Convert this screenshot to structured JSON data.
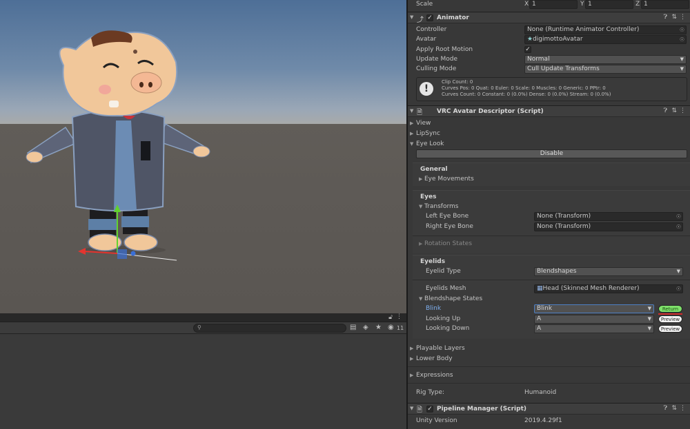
{
  "scene": {
    "gizmo_colors": {
      "x": "#e3352f",
      "y": "#62d22e",
      "z": "#3a6fd6"
    }
  },
  "bottom_panel": {
    "lock_icon": "lock-icon",
    "search_placeholder": "",
    "hidden_count": "11"
  },
  "inspector": {
    "transform_scale": {
      "label": "Scale",
      "x_label": "X",
      "x": "1",
      "y_label": "Y",
      "y": "1",
      "z_label": "Z",
      "z": "1"
    },
    "animator": {
      "title": "Animator",
      "enabled": true,
      "controller_label": "Controller",
      "controller_value": "None (Runtime Animator Controller)",
      "avatar_label": "Avatar",
      "avatar_value": "digimottoAvatar",
      "apply_root_motion_label": "Apply Root Motion",
      "update_mode_label": "Update Mode",
      "update_mode_value": "Normal",
      "culling_mode_label": "Culling Mode",
      "culling_mode_value": "Cull Update Transforms",
      "info_line1": "Clip Count: 0",
      "info_line2": "Curves Pos: 0 Quat: 0 Euler: 0 Scale: 0 Muscles: 0 Generic: 0 PPtr: 0",
      "info_line3": "Curves Count: 0 Constant: 0 (0.0%) Dense: 0 (0.0%) Stream: 0 (0.0%)"
    },
    "descriptor": {
      "title": "VRC Avatar Descriptor (Script)",
      "view": "View",
      "lipsync": "LipSync",
      "eye_look": "Eye Look",
      "disable_button": "Disable",
      "general_header": "General",
      "eye_movements": "Eye Movements",
      "eyes_header": "Eyes",
      "transforms": "Transforms",
      "left_eye_label": "Left Eye Bone",
      "left_eye_value": "None (Transform)",
      "right_eye_label": "Right Eye Bone",
      "right_eye_value": "None (Transform)",
      "rotation_states": "Rotation States",
      "eyelids_header": "Eyelids",
      "eyelid_type_label": "Eyelid Type",
      "eyelid_type_value": "Blendshapes",
      "eyelids_mesh_label": "Eyelids Mesh",
      "eyelids_mesh_value": "Head (Skinned Mesh Renderer)",
      "blendshape_states": "Blendshape States",
      "states": [
        {
          "label": "Blink",
          "value": "Blink",
          "button": "Return"
        },
        {
          "label": "Looking Up",
          "value": "A",
          "button": "Preview"
        },
        {
          "label": "Looking Down",
          "value": "A",
          "button": "Preview"
        }
      ],
      "playable_layers": "Playable Layers",
      "lower_body": "Lower Body",
      "expressions": "Expressions",
      "rig_type_label": "Rig Type:",
      "rig_type_value": "Humanoid"
    },
    "pipeline": {
      "title": "Pipeline Manager (Script)",
      "unity_version_label": "Unity Version",
      "unity_version_value": "2019.4.29f1"
    }
  }
}
